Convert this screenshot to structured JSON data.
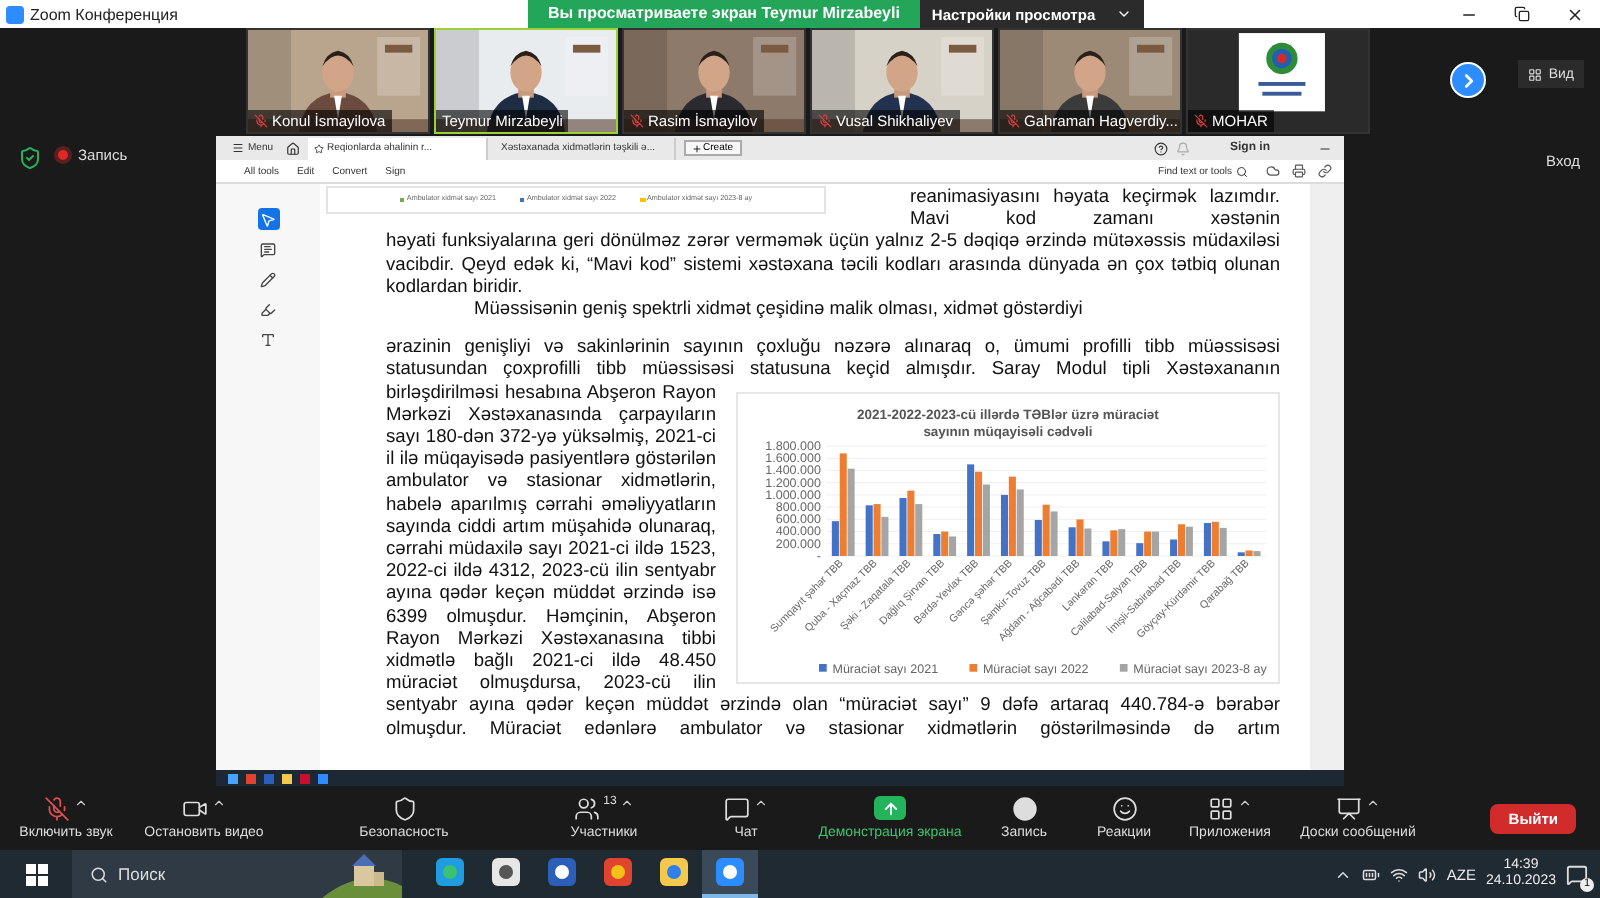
{
  "window": {
    "title": "Zoom Конференция",
    "banner": "Вы просматриваете экран Teymur Mirzabeyli",
    "view_options": "Настройки просмотра"
  },
  "participants": [
    {
      "name": "Konul İsmayilova",
      "muted": true,
      "speaking": false,
      "kind": "camera"
    },
    {
      "name": "Teymur Mirzabeyli",
      "muted": false,
      "speaking": true,
      "kind": "camera"
    },
    {
      "name": "Rasim İsmayilov",
      "muted": true,
      "speaking": false,
      "kind": "camera"
    },
    {
      "name": "Vusal Shikhaliyev",
      "muted": true,
      "speaking": false,
      "kind": "camera"
    },
    {
      "name": "Gahraman Hagverdiy...",
      "muted": true,
      "speaking": false,
      "kind": "camera"
    },
    {
      "name": "MOHAR",
      "muted": true,
      "speaking": false,
      "kind": "logo"
    }
  ],
  "view_button": "Вид",
  "recording": {
    "label": "Запись"
  },
  "sign_in": "Вход",
  "shared_screen": {
    "menu_label": "Menu",
    "tabs": [
      {
        "label": "Reqionlarda əhalinin r...",
        "selected": true
      },
      {
        "label": "Xəstəxanada xidmətlərin təşkili ə...",
        "selected": false
      }
    ],
    "create_label": "Create",
    "browser_sign_in": "Sign in",
    "menu_items": [
      "All tools",
      "Edit",
      "Convert",
      "Sign"
    ],
    "find_label": "Find text or tools",
    "document": {
      "legend": [
        {
          "label": "Ambulator xidmət sayı 2021",
          "color": "#70ad47"
        },
        {
          "label": "Ambulator xidmət sayı 2022",
          "color": "#4472c4"
        },
        {
          "label": "Ambulator xidmət sayı 2023-8 ay",
          "color": "#ffc000"
        }
      ],
      "side_text": "reanimasiyasını həyata keçirmək lazımdır. Mavi kod zamanı xəstənin",
      "paragraph_1": "həyati funksiyalarına geri dönülməz zərər verməmək üçün yalnız 2-5 dəqiqə ərzində mütəxəssis müdaxiləsi vacibdir.  Qeyd edək ki, “Mavi kod” sistemi xəstəxana təcili kodları arasında dünyada ən çox tətbiq olunan kodlardan biridir.",
      "paragraph_2": "Müəssisənin geniş spektrli xidmət çeşidinə malik olması, xidmət göstərdiyi",
      "paragraph_3": "ərazinin genişliyi və sakinlərinin sayının çoxluğu nəzərə alınaraq o, ümumi profilli tibb müəssisəsi statusundan çoxprofilli tibb müəssisəsi statusuna keçid almışdır. Saray Modul tipli Xəstəxananın",
      "column_text": "birləşdirilməsi hesabına Abşeron Rayon Mərkəzi Xəstəxanasında çarpayıların sayı 180-dən 372-yə yüksəlmiş, 2021-ci il ilə müqayisədə pasiyentlərə göstərilən ambulator və stasionar xidmətlərin, habelə aparılmış cərrahi əməliyyatların sayında ciddi artım müşahidə olunaraq, cərrahi müdaxilə sayı 2021-ci ildə 1523, 2022-ci ildə 4312, 2023-cü ilin sentyabr ayına qədər keçən müddət ərzində isə 6399 olmuşdur. Həmçinin, Abşeron Rayon Mərkəzi Xəstəxanasına tibbi xidmətlə bağlı 2021-ci ildə 48.450 müraciət olmuşdursa, 2023-cü ilin",
      "closing_text": "sentyabr ayına qədər keçən müddət ərzində olan “müraciət sayı” 9 dəfə artaraq 440.784-ə bərabər olmuşdur. Müraciət edənlərə ambulator və stasionar xidmətlərin göstərilməsində də artım",
      "chart_data": {
        "type": "bar",
        "title": "2021-2022-2023-cü illərdə TƏBlər üzrə müraciət sayının müqayisəli cədvəli",
        "categories": [
          "Sumqayıt şəhər TBB",
          "Quba - Xaçmaz TBB",
          "Şəki - Zaqatala TBB",
          "Dağlıq Şirvan TBB",
          "Bərdə-Yevlax TBB",
          "Gəncə şəhər TBB",
          "Şəmkir-Tovuz TBB",
          "Ağdam - Ağcabədi TBB",
          "Lənkəran TBB",
          "Cəlilabad-Salyan TBB",
          "İmişli-Sabirabad TBB",
          "Göyçay-Kürdəmir TBB",
          "Qarabağ TBB"
        ],
        "series": [
          {
            "name": "Müraciət sayı 2021",
            "color": "#4472c4",
            "values": [
              570000,
              830000,
              950000,
              360000,
              1500000,
              1000000,
              590000,
              470000,
              240000,
              210000,
              270000,
              540000,
              60000
            ]
          },
          {
            "name": "Müraciət sayı 2022",
            "color": "#ed7d31",
            "values": [
              1680000,
              850000,
              1070000,
              400000,
              1380000,
              1300000,
              840000,
              600000,
              420000,
              400000,
              520000,
              560000,
              90000
            ]
          },
          {
            "name": "Müraciət sayı 2023-8 ay",
            "color": "#a5a5a5",
            "values": [
              1430000,
              640000,
              850000,
              320000,
              1170000,
              1090000,
              730000,
              450000,
              440000,
              400000,
              480000,
              460000,
              80000
            ]
          }
        ],
        "ylim": [
          0,
          1800000
        ],
        "grid": true,
        "legend": true,
        "yticks": [
          {
            "value": 0,
            "label": "-"
          },
          {
            "value": 200000,
            "label": "200.000"
          },
          {
            "value": 400000,
            "label": "400.000"
          },
          {
            "value": 600000,
            "label": "600.000"
          },
          {
            "value": 800000,
            "label": "800.000"
          },
          {
            "value": 1000000,
            "label": "1.000.000"
          },
          {
            "value": 1200000,
            "label": "1.200.000"
          },
          {
            "value": 1400000,
            "label": "1.400.000"
          },
          {
            "value": 1600000,
            "label": "1.600.000"
          },
          {
            "value": 1800000,
            "label": "1.800.000"
          }
        ]
      }
    }
  },
  "toolbar": [
    {
      "kind": "mic",
      "label": "Включить звук",
      "muted": true,
      "has_menu": true
    },
    {
      "kind": "video",
      "label": "Остановить видео",
      "has_menu": true
    },
    {
      "kind": "security",
      "label": "Безопасность",
      "has_menu": false
    },
    {
      "kind": "participants",
      "label": "Участники",
      "count": "13",
      "has_menu": true
    },
    {
      "kind": "chat",
      "label": "Чат",
      "has_menu": true
    },
    {
      "kind": "share",
      "label": "Демонстрация экрана",
      "has_menu": false
    },
    {
      "kind": "record",
      "label": "Запись",
      "has_menu": false
    },
    {
      "kind": "reactions",
      "label": "Реакции",
      "has_menu": false
    },
    {
      "kind": "apps",
      "label": "Приложения",
      "has_menu": true
    },
    {
      "kind": "whiteboards",
      "label": "Доски сообщений",
      "has_menu": true
    }
  ],
  "leave_button": "Выйти",
  "taskbar": {
    "search_placeholder": "Поиск",
    "apps": [
      {
        "kind": "edge",
        "selected": false
      },
      {
        "kind": "roblox",
        "selected": false
      },
      {
        "kind": "word",
        "selected": false
      },
      {
        "kind": "chrome",
        "selected": false
      },
      {
        "kind": "files",
        "selected": false
      },
      {
        "kind": "zoom",
        "selected": true
      }
    ],
    "language": "AZE",
    "time": "14:39",
    "date": "24.10.2023",
    "notifications": "1"
  }
}
